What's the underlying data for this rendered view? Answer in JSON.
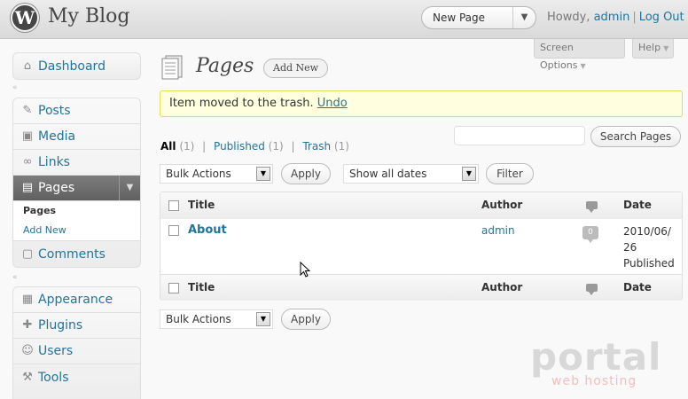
{
  "header": {
    "site_title": "My Blog",
    "favorites": "New Page",
    "howdy": "Howdy,",
    "username": "admin",
    "separator": "|",
    "logout": "Log Out"
  },
  "tabs": {
    "screen_options": "Screen Options",
    "help": "Help"
  },
  "sidebar": {
    "dashboard": "Dashboard",
    "posts": "Posts",
    "media": "Media",
    "links": "Links",
    "pages": "Pages",
    "pages_sub_all": "Pages",
    "pages_sub_add": "Add New",
    "comments": "Comments",
    "appearance": "Appearance",
    "plugins": "Plugins",
    "users": "Users",
    "tools": "Tools"
  },
  "main": {
    "title": "Pages",
    "add_new": "Add New",
    "notice_text": "Item moved to the trash.",
    "notice_undo": "Undo",
    "filters": {
      "all": "All",
      "all_count": "(1)",
      "published": "Published",
      "published_count": "(1)",
      "trash": "Trash",
      "trash_count": "(1)"
    },
    "search_button": "Search Pages",
    "bulk_actions": "Bulk Actions",
    "apply": "Apply",
    "dates": "Show all dates",
    "filter": "Filter"
  },
  "table": {
    "columns": {
      "title": "Title",
      "author": "Author",
      "date": "Date"
    },
    "rows": [
      {
        "title": "About",
        "author": "admin",
        "comments": "0",
        "date": "2010/06/",
        "date2": "26",
        "status": "Published"
      }
    ]
  },
  "watermark": {
    "brand": "portal",
    "tagline": "web hosting"
  },
  "colors": {
    "link": "#21759b",
    "notice_bg": "#ffffe0",
    "notice_border": "#e6db55",
    "active_menu": "#6d6d6d"
  }
}
